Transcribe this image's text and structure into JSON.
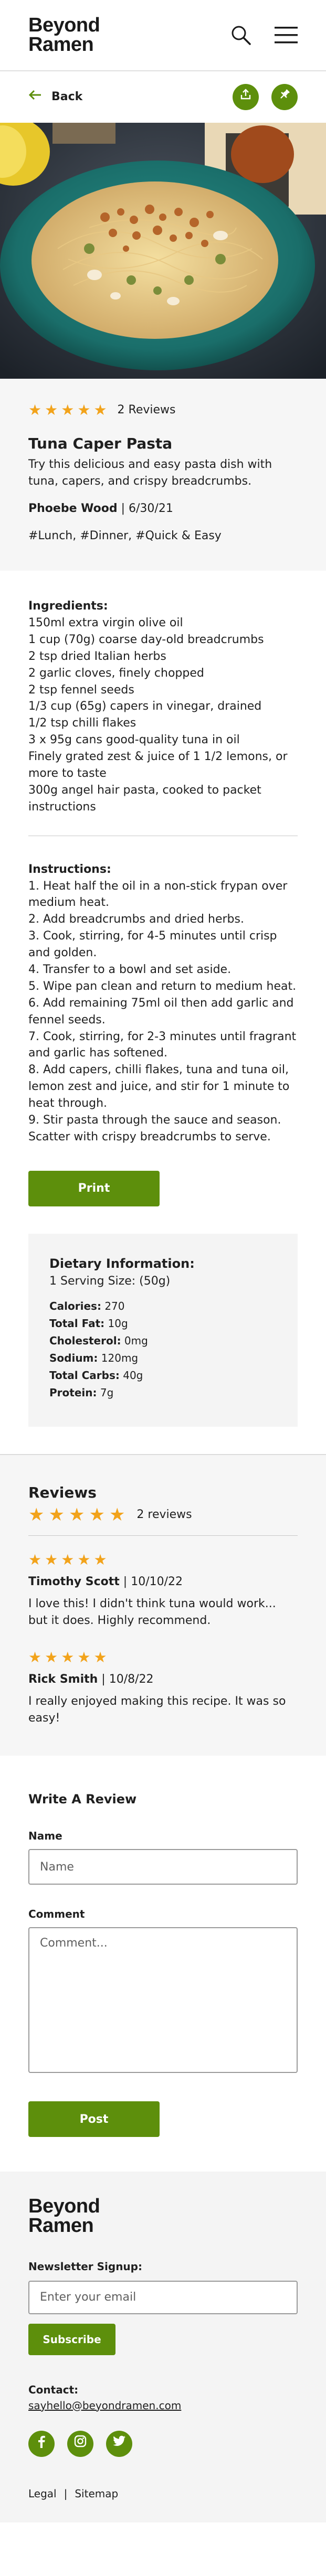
{
  "brand": {
    "name_line1": "Beyond",
    "name_line2": "Ramen",
    "accent": "#5d8f0c",
    "star_color": "#f2a31b"
  },
  "header": {
    "icons": [
      "search-icon",
      "hamburger-menu-icon"
    ]
  },
  "nav": {
    "back_label": "Back",
    "actions": [
      "share-icon",
      "pin-icon"
    ]
  },
  "recipe": {
    "rating": 5,
    "review_count_label": "2 Reviews",
    "title": "Tuna Caper Pasta",
    "description": "Try this delicious and easy pasta dish with tuna, capers, and crispy breadcrumbs.",
    "author": "Phoebe Wood",
    "date": "6/30/21",
    "tags": "#Lunch, #Dinner, #Quick & Easy"
  },
  "ingredients": {
    "heading": "Ingredients:",
    "items": [
      "150ml extra virgin olive oil",
      "1 cup (70g) coarse day-old breadcrumbs",
      "2 tsp dried Italian herbs",
      "2 garlic cloves, finely chopped",
      "2 tsp fennel seeds",
      "1/3 cup (65g) capers in vinegar, drained",
      "1/2 tsp chilli flakes",
      "3 x 95g cans good-quality tuna in oil",
      "Finely grated zest & juice of 1 1/2 lemons, or more to taste",
      "300g angel hair pasta, cooked to packet instructions"
    ]
  },
  "instructions": {
    "heading": "Instructions:",
    "steps": [
      "1. Heat half the oil in a non-stick frypan over medium heat.",
      "2. Add breadcrumbs and dried herbs.",
      "3. Cook, stirring, for 4-5 minutes until crisp and golden.",
      "4. Transfer to a bowl and set aside.",
      "5. Wipe pan clean and return to medium heat.",
      "6. Add remaining 75ml oil then add garlic and fennel seeds.",
      "7. Cook, stirring, for 2-3 minutes until fragrant and garlic has softened.",
      "8. Add capers, chilli flakes, tuna and tuna oil, lemon zest and juice, and stir for 1 minute to heat through.",
      "9. Stir pasta through the sauce and season. Scatter with crispy breadcrumbs to serve."
    ]
  },
  "print_label": "Print",
  "dietary": {
    "heading": "Dietary Information:",
    "serving": "1 Serving Size: (50g)",
    "facts": [
      {
        "label": "Calories:",
        "value": "270"
      },
      {
        "label": "Total Fat:",
        "value": "10g"
      },
      {
        "label": "Cholesterol:",
        "value": "0mg"
      },
      {
        "label": "Sodium:",
        "value": "120mg"
      },
      {
        "label": "Total Carbs:",
        "value": "40g"
      },
      {
        "label": "Protein:",
        "value": "7g"
      }
    ]
  },
  "reviews": {
    "heading": "Reviews",
    "count_label": "2 reviews",
    "items": [
      {
        "rating": 5,
        "author": "Timothy Scott",
        "date": "10/10/22",
        "text": "I love this! I didn't think tuna would work... but it does. Highly recommend."
      },
      {
        "rating": 5,
        "author": "Rick Smith",
        "date": "10/8/22",
        "text": "I really enjoyed making this recipe. It was so easy!"
      }
    ]
  },
  "review_form": {
    "heading": "Write A Review",
    "name_label": "Name",
    "name_placeholder": "Name",
    "comment_label": "Comment",
    "comment_placeholder": "Comment...",
    "submit_label": "Post"
  },
  "footer": {
    "newsletter_label": "Newsletter Signup:",
    "email_placeholder": "Enter your email",
    "subscribe_label": "Subscribe",
    "contact_label": "Contact:",
    "contact_email": "sayhello@beyondramen.com",
    "socials": [
      "facebook-icon",
      "instagram-icon",
      "twitter-icon"
    ],
    "legal_label": "Legal",
    "legal_separator": "|",
    "sitemap_label": "Sitemap"
  }
}
